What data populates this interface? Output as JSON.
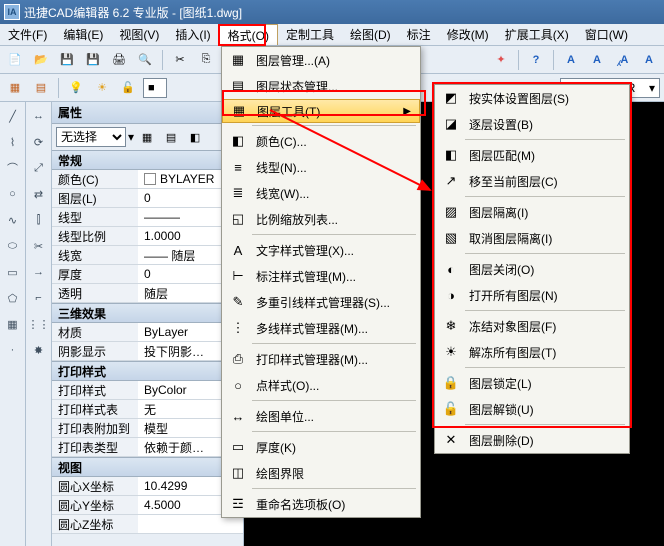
{
  "title": "迅捷CAD编辑器 6.2 专业版 - [图纸1.dwg]",
  "menubar": [
    "文件(F)",
    "编辑(E)",
    "视图(V)",
    "插入(I)",
    "格式(O)",
    "定制工具",
    "绘图(D)",
    "标注",
    "修改(M)",
    "扩展工具(X)",
    "窗口(W)"
  ],
  "menubar_active_index": 4,
  "prop": {
    "title": "属性",
    "selector": "无选择",
    "cats": [
      {
        "name": "常规",
        "rows": [
          {
            "k": "颜色(C)",
            "v": "BYLAYER",
            "swatch": true
          },
          {
            "k": "图层(L)",
            "v": "0"
          },
          {
            "k": "线型",
            "v": "———"
          },
          {
            "k": "线型比例",
            "v": "1.0000"
          },
          {
            "k": "线宽",
            "v": "—— 随层"
          },
          {
            "k": "厚度",
            "v": "0"
          },
          {
            "k": "透明",
            "v": "随层"
          }
        ]
      },
      {
        "name": "三维效果",
        "rows": [
          {
            "k": "材质",
            "v": "ByLayer"
          },
          {
            "k": "阴影显示",
            "v": "投下阴影…"
          }
        ]
      },
      {
        "name": "打印样式",
        "rows": [
          {
            "k": "打印样式",
            "v": "ByColor"
          },
          {
            "k": "打印样式表",
            "v": "无"
          },
          {
            "k": "打印表附加到",
            "v": "模型"
          },
          {
            "k": "打印表类型",
            "v": "依赖于颜…"
          }
        ]
      },
      {
        "name": "视图",
        "rows": [
          {
            "k": "圆心X坐标",
            "v": "10.4299"
          },
          {
            "k": "圆心Y坐标",
            "v": "4.5000"
          },
          {
            "k": "圆心Z坐标",
            "v": ""
          }
        ]
      }
    ]
  },
  "layer_label": "BYLAYER",
  "format_menu": [
    {
      "icon": "▦",
      "label": "图层管理...(A)"
    },
    {
      "icon": "▤",
      "label": "图层状态管理..."
    },
    {
      "icon": "▦",
      "label": "图层工具(T)",
      "arrow": true,
      "hover": true
    },
    {
      "sep": true
    },
    {
      "icon": "◧",
      "label": "颜色(C)..."
    },
    {
      "icon": "≡",
      "label": "线型(N)..."
    },
    {
      "icon": "≣",
      "label": "线宽(W)..."
    },
    {
      "icon": "◱",
      "label": "比例缩放列表..."
    },
    {
      "sep": true
    },
    {
      "icon": "A",
      "label": "文字样式管理(X)..."
    },
    {
      "icon": "⊢",
      "label": "标注样式管理(M)..."
    },
    {
      "icon": "✎",
      "label": "多重引线样式管理器(S)..."
    },
    {
      "icon": "⋮",
      "label": "多线样式管理器(M)..."
    },
    {
      "sep": true
    },
    {
      "icon": "⎙",
      "label": "打印样式管理器(M)..."
    },
    {
      "icon": "○",
      "label": "点样式(O)..."
    },
    {
      "sep": true
    },
    {
      "icon": "↔",
      "label": "绘图单位..."
    },
    {
      "sep": true
    },
    {
      "icon": "▭",
      "label": "厚度(K)"
    },
    {
      "icon": "◫",
      "label": "绘图界限"
    },
    {
      "sep": true
    },
    {
      "icon": "☲",
      "label": "重命名选项板(O)"
    }
  ],
  "submenu": [
    {
      "icon": "◩",
      "label": "按实体设置图层(S)"
    },
    {
      "icon": "◪",
      "label": "逐层设置(B)"
    },
    {
      "sep": true
    },
    {
      "icon": "◧",
      "label": "图层匹配(M)"
    },
    {
      "icon": "↗",
      "label": "移至当前图层(C)"
    },
    {
      "sep": true
    },
    {
      "icon": "▨",
      "label": "图层隔离(I)"
    },
    {
      "icon": "▧",
      "label": "取消图层隔离(I)"
    },
    {
      "sep": true
    },
    {
      "icon": "◐",
      "label": "图层关闭(O)"
    },
    {
      "icon": "◑",
      "label": "打开所有图层(N)"
    },
    {
      "sep": true
    },
    {
      "icon": "❄",
      "label": "冻结对象图层(F)"
    },
    {
      "icon": "☀",
      "label": "解冻所有图层(T)"
    },
    {
      "sep": true
    },
    {
      "icon": "🔒",
      "label": "图层锁定(L)"
    },
    {
      "icon": "🔓",
      "label": "图层解锁(U)"
    },
    {
      "sep": true
    },
    {
      "icon": "✕",
      "label": "图层删除(D)"
    }
  ]
}
